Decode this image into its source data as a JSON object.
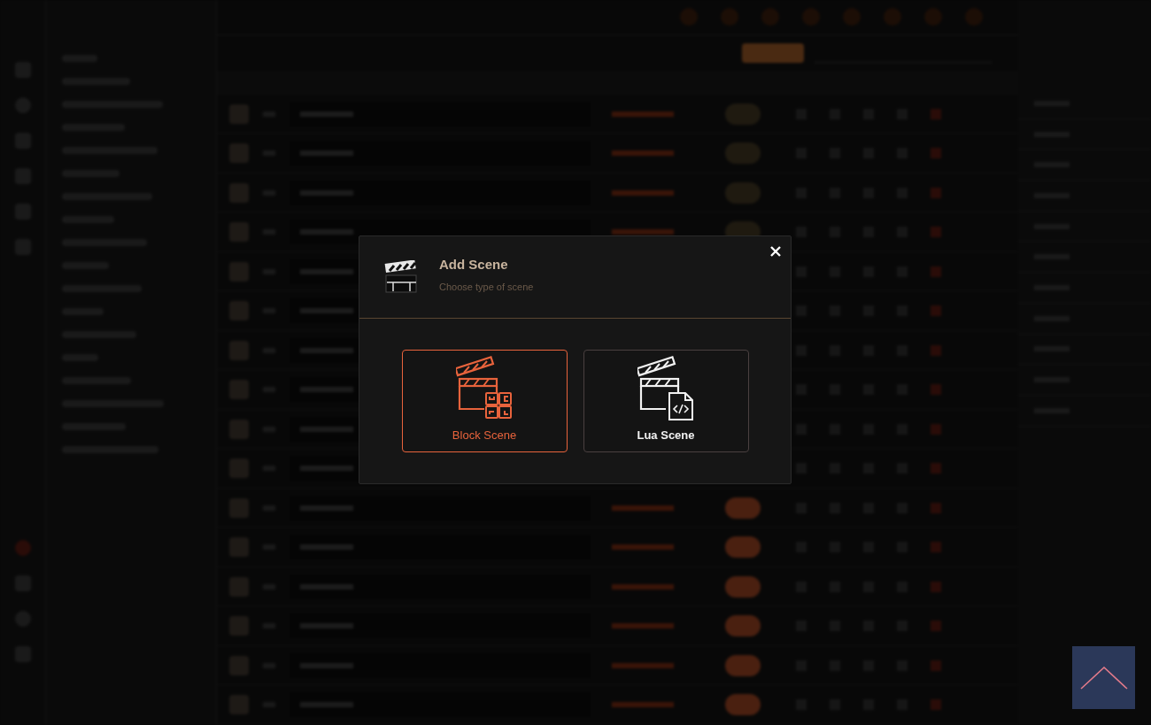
{
  "dialog": {
    "title": "Add Scene",
    "subtitle": "Choose type of scene",
    "options": [
      {
        "kind": "block",
        "label": "Block Scene",
        "selected": true
      },
      {
        "kind": "lua",
        "label": "Lua Scene",
        "selected": false
      }
    ]
  }
}
